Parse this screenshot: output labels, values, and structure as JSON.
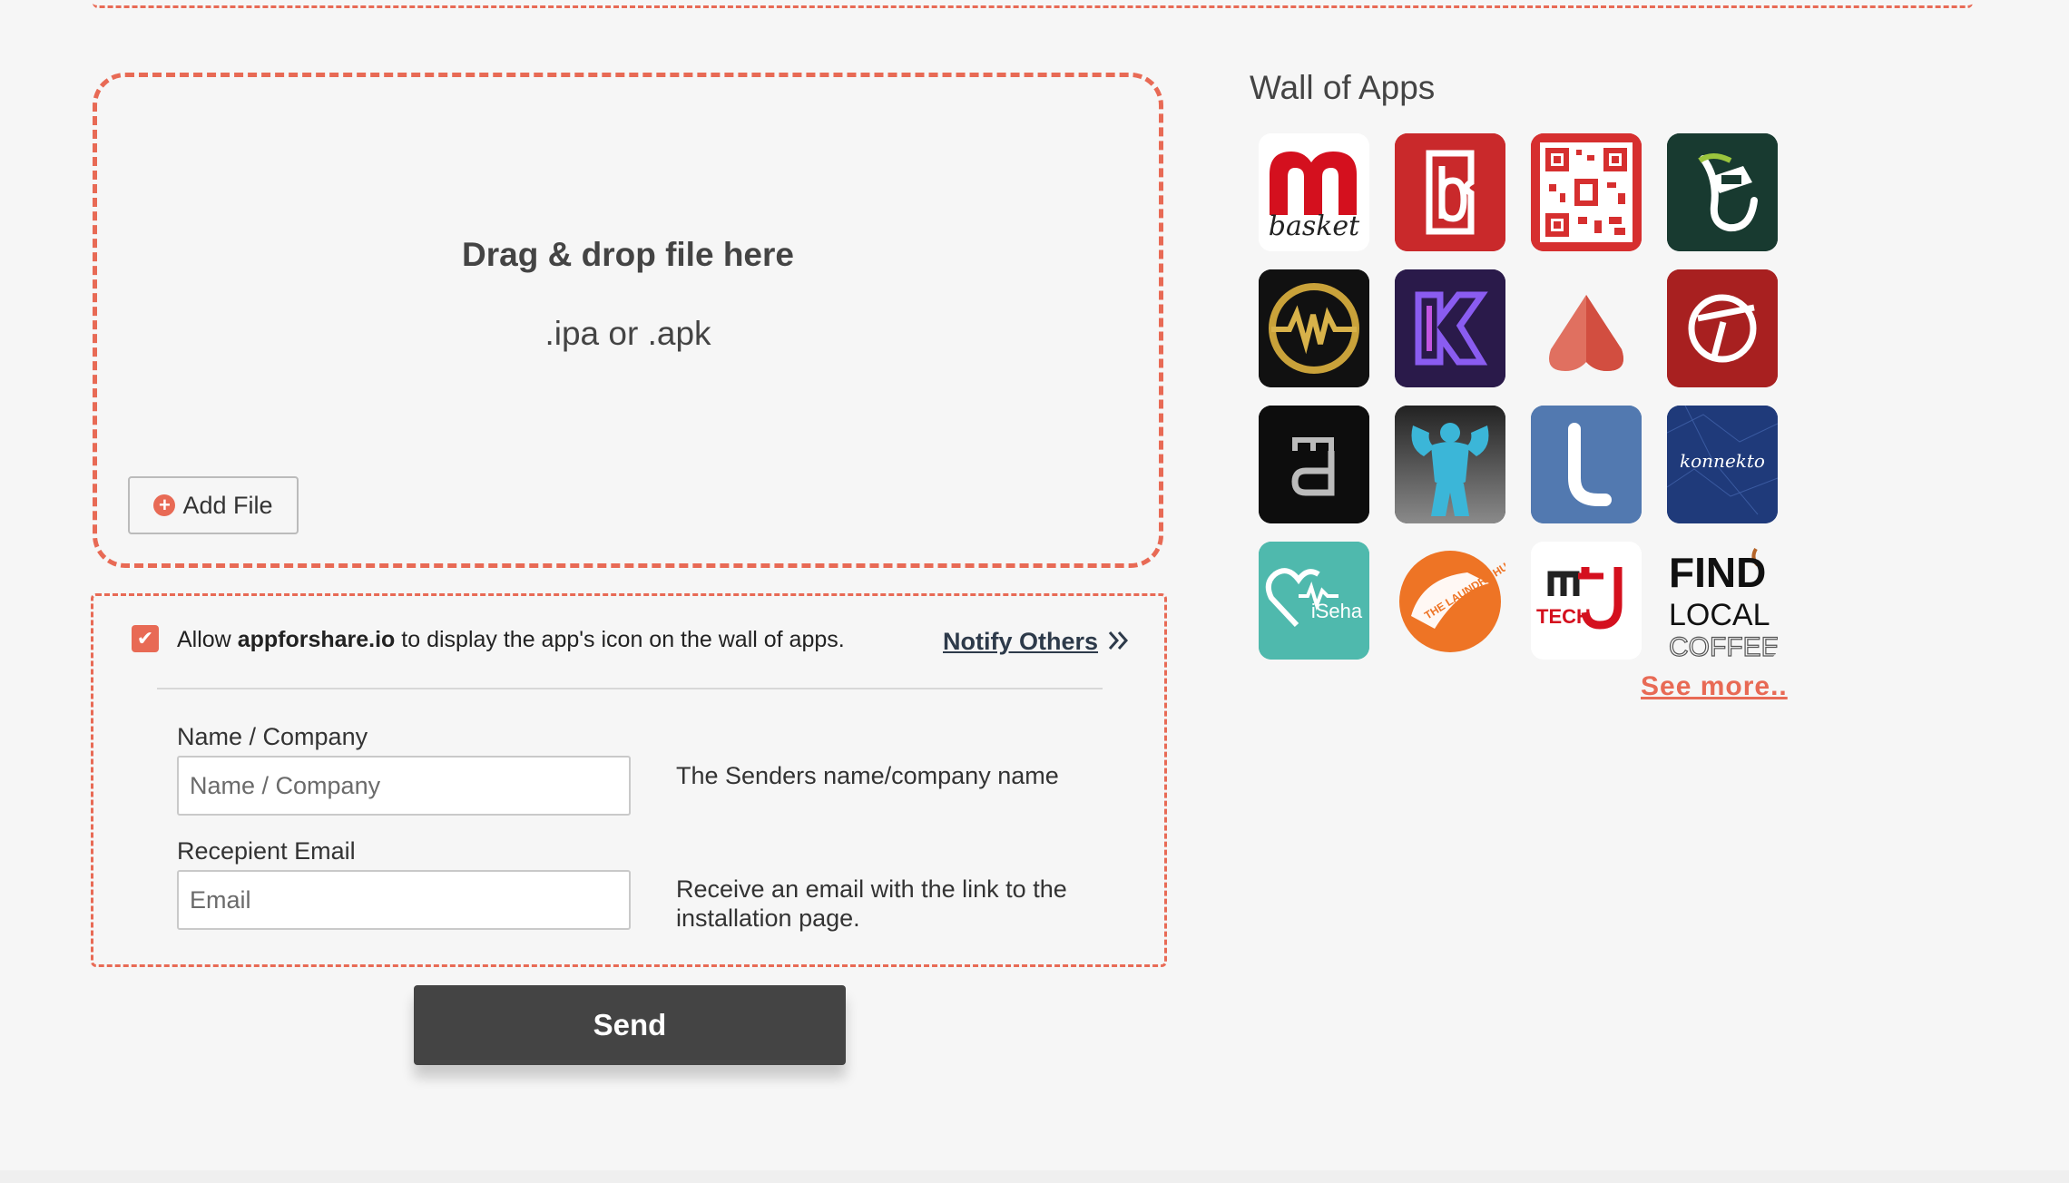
{
  "dropzone": {
    "title": "Drag & drop file here",
    "subtitle": ".ipa or .apk",
    "add_file_label": "Add File"
  },
  "options": {
    "allow_prefix": "Allow ",
    "allow_site": "appforshare.io",
    "allow_suffix": " to display the app's icon on the wall of apps.",
    "allow_checked": true,
    "notify_label": "Notify Others",
    "name_label": "Name / Company",
    "name_placeholder": "Name / Company",
    "name_help": "The Senders name/company name",
    "email_label": "Recepient Email",
    "email_placeholder": "Email",
    "email_help": "Receive an email with the link to the installation page."
  },
  "send_label": "Send",
  "wall": {
    "title": "Wall of Apps",
    "see_more": "See more..",
    "apps": [
      {
        "name": "basket",
        "icon": "m-basket-icon",
        "text": "basket"
      },
      {
        "name": "b-ticket",
        "icon": "b-ticket-icon",
        "text": ""
      },
      {
        "name": "qr-code",
        "icon": "qr-code-icon",
        "text": ""
      },
      {
        "name": "green-hand",
        "icon": "hand-icon",
        "text": ""
      },
      {
        "name": "gold-pulse",
        "icon": "pulse-icon",
        "text": ""
      },
      {
        "name": "purple-k",
        "icon": "k-logo-icon",
        "text": ""
      },
      {
        "name": "red-heart",
        "icon": "heart-icon",
        "text": ""
      },
      {
        "name": "red-circle",
        "icon": "circle-arrow-icon",
        "text": ""
      },
      {
        "name": "dark-md",
        "icon": "md-logo-icon",
        "text": ""
      },
      {
        "name": "fitness",
        "icon": "muscle-icon",
        "text": ""
      },
      {
        "name": "blue-l",
        "icon": "l-logo-icon",
        "text": ""
      },
      {
        "name": "konnekto",
        "icon": "konnekto-icon",
        "text": "konnekto"
      },
      {
        "name": "iseha",
        "icon": "heart-pulse-icon",
        "text": "iSeha"
      },
      {
        "name": "laundry-hub",
        "icon": "laundry-icon",
        "text": "THE LAUNDRY HUB"
      },
      {
        "name": "mj-tech",
        "icon": "mj-logo-icon",
        "text": "TECH"
      },
      {
        "name": "find-local-coffee",
        "icon": "coffee-icon",
        "text": "FIND LOCAL COFFEE"
      }
    ]
  },
  "colors": {
    "accent": "#e86a55",
    "button": "#444444",
    "background": "#f6f6f6"
  }
}
